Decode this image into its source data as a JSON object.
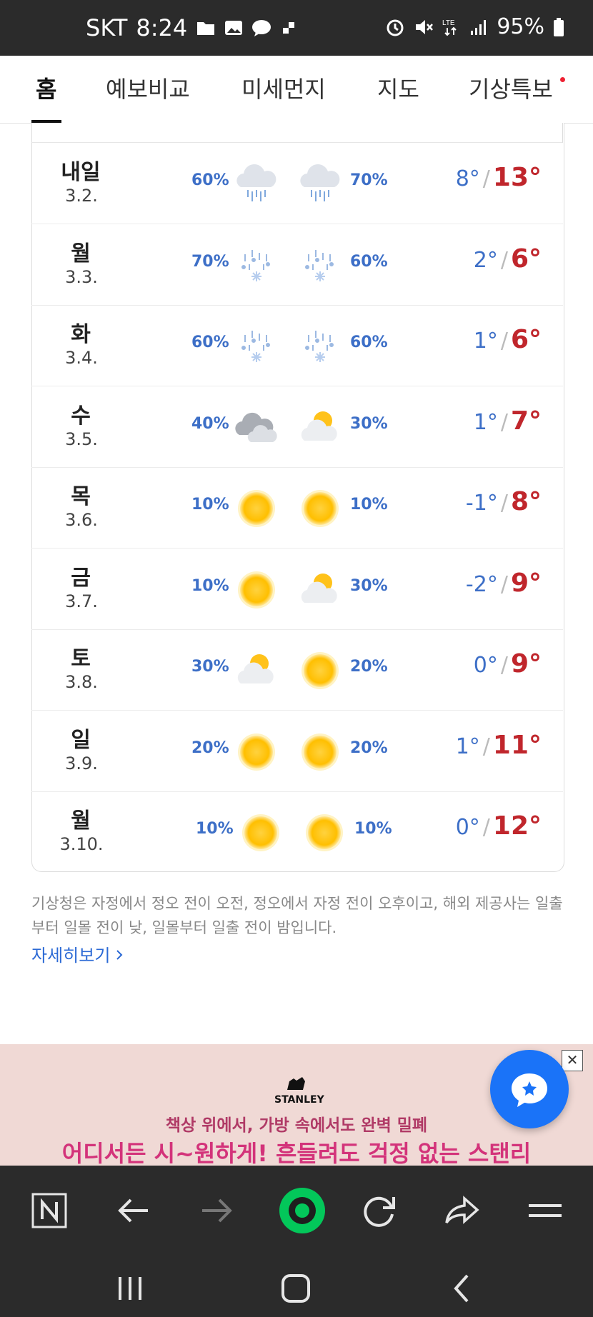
{
  "status_bar": {
    "carrier": "SKT",
    "time": "8:24",
    "battery": "95%"
  },
  "tabs": [
    {
      "label": "홈",
      "active": true
    },
    {
      "label": "예보비교"
    },
    {
      "label": "미세먼지"
    },
    {
      "label": "지도"
    },
    {
      "label": "기상특보"
    }
  ],
  "forecast": [
    {
      "day": "내일",
      "date": "3.2.",
      "am_pct": "60%",
      "am_icon": "rain-icon",
      "pm_pct": "70%",
      "pm_icon": "rain-icon",
      "low": "8°",
      "high": "13°"
    },
    {
      "day": "월",
      "date": "3.3.",
      "am_pct": "70%",
      "am_icon": "sleet-icon",
      "pm_pct": "60%",
      "pm_icon": "sleet-icon",
      "low": "2°",
      "high": "6°"
    },
    {
      "day": "화",
      "date": "3.4.",
      "am_pct": "60%",
      "am_icon": "sleet-icon",
      "pm_pct": "60%",
      "pm_icon": "sleet-icon",
      "low": "1°",
      "high": "6°"
    },
    {
      "day": "수",
      "date": "3.5.",
      "am_pct": "40%",
      "am_icon": "cloudy-icon",
      "pm_pct": "30%",
      "pm_icon": "partly-cloudy-icon",
      "low": "1°",
      "high": "7°"
    },
    {
      "day": "목",
      "date": "3.6.",
      "am_pct": "10%",
      "am_icon": "sunny-icon",
      "pm_pct": "10%",
      "pm_icon": "sunny-icon",
      "low": "-1°",
      "high": "8°"
    },
    {
      "day": "금",
      "date": "3.7.",
      "am_pct": "10%",
      "am_icon": "sunny-icon",
      "pm_pct": "30%",
      "pm_icon": "partly-cloudy-icon",
      "low": "-2°",
      "high": "9°"
    },
    {
      "day": "토",
      "date": "3.8.",
      "am_pct": "30%",
      "am_icon": "partly-cloudy-icon",
      "pm_pct": "20%",
      "pm_icon": "sunny-icon",
      "low": "0°",
      "high": "9°"
    },
    {
      "day": "일",
      "date": "3.9.",
      "am_pct": "20%",
      "am_icon": "sunny-icon",
      "pm_pct": "20%",
      "pm_icon": "sunny-icon",
      "low": "1°",
      "high": "11°"
    },
    {
      "day": "월",
      "date": "3.10.",
      "am_pct": "10%",
      "am_icon": "sunny-icon",
      "pm_pct": "10%",
      "pm_icon": "sunny-icon",
      "low": "0°",
      "high": "12°"
    }
  ],
  "temp_separator": "/",
  "note": "기상청은 자정에서 정오 전이 오전, 정오에서 자정 전이 오후이고, 해외 제공사는 일출부터 일몰 전이 낮, 일몰부터 일출 전이 밤입니다.",
  "more_link": "자세히보기",
  "ad": {
    "brand": "STANLEY",
    "line1": "책상 위에서, 가방 속에서도 완벽 밀폐",
    "line2": "어디서든 시~원하게! 흔들려도 걱정 없는 스탠리",
    "close": "✕"
  },
  "colors": {
    "low_temp": "#3d6fc7",
    "high_temp": "#c0262c",
    "fab": "#1a73f8",
    "bar": "#2b2b2b"
  }
}
